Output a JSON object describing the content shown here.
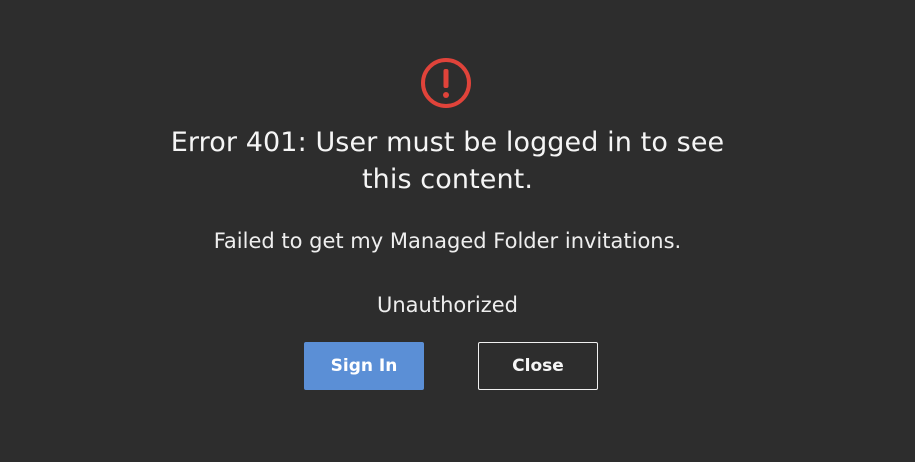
{
  "dialog": {
    "icon": "error-circle-exclamation-icon",
    "icon_color": "#e0433a",
    "title": "Error 401: User must be logged in to see this content.",
    "message": "Failed to get my Managed Folder invitations.",
    "reason": "Unauthorized",
    "sign_in_label": "Sign In",
    "close_label": "Close"
  },
  "colors": {
    "background": "#2d2d2d",
    "primary_button": "#5b8fd6",
    "text": "#f2f2f2"
  }
}
